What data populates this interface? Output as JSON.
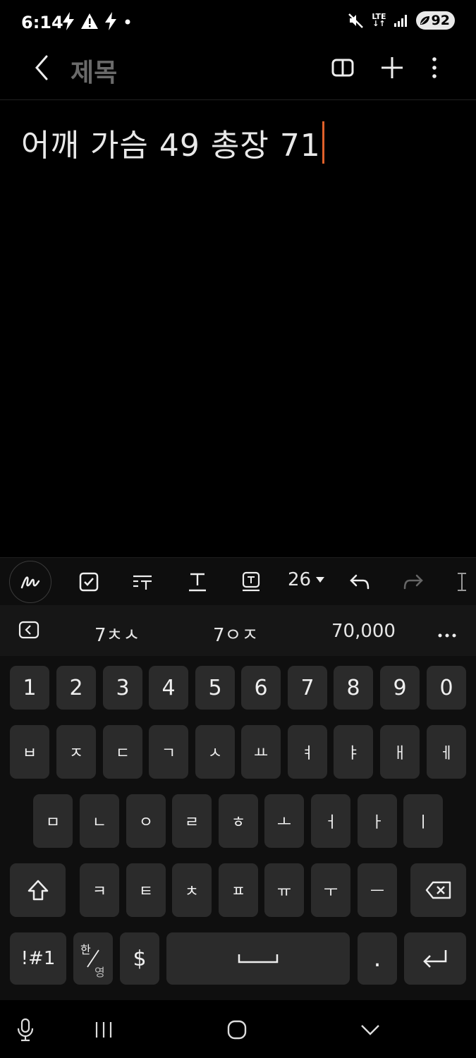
{
  "status_bar": {
    "time": "6:14",
    "network": "LTE",
    "battery": "92"
  },
  "app_bar": {
    "title": "제목"
  },
  "note": {
    "text": "어깨 가슴 49 총장 71"
  },
  "toolbar": {
    "font_size": "26"
  },
  "suggestions": [
    "7ㅊㅅ",
    "7ㅇㅈ",
    "70,000"
  ],
  "keyboard": {
    "number_row": [
      "1",
      "2",
      "3",
      "4",
      "5",
      "6",
      "7",
      "8",
      "9",
      "0"
    ],
    "row1": [
      "ㅂ",
      "ㅈ",
      "ㄷ",
      "ㄱ",
      "ㅅ",
      "ㅛ",
      "ㅕ",
      "ㅑ",
      "ㅐ",
      "ㅔ"
    ],
    "row2": [
      "ㅁ",
      "ㄴ",
      "ㅇ",
      "ㄹ",
      "ㅎ",
      "ㅗ",
      "ㅓ",
      "ㅏ",
      "ㅣ"
    ],
    "row3": [
      "ㅋ",
      "ㅌ",
      "ㅊ",
      "ㅍ",
      "ㅠ",
      "ㅜ",
      "ㅡ"
    ],
    "symbols_label": "!#1",
    "lang_top": "한",
    "lang_bottom": "영",
    "currency": "$",
    "period": "."
  },
  "colors": {
    "background": "#000000",
    "key": "#2b2b2b",
    "cursor": "#e0612a",
    "title": "#6a6a6a"
  }
}
